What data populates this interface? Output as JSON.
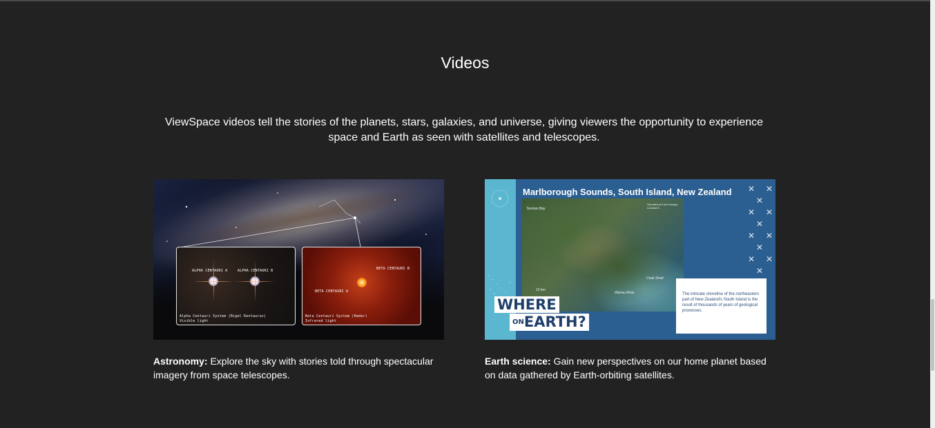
{
  "section": {
    "title": "Videos",
    "intro": "ViewSpace videos tell the stories of the planets, stars, galaxies, and universe, giving viewers the opportunity to experience space and Earth as seen with satellites and telescopes."
  },
  "cards": [
    {
      "category": "Astronomy:",
      "description": "Explore the sky with stories told through spectacular imagery from space telescopes.",
      "image": {
        "label_alpha_a": "ALPHA CENTAURI A",
        "label_alpha_b": "ALPHA CENTAURI B",
        "label_beta_a": "BETA CENTAURI A",
        "label_beta_b": "BETA CENTAURI B",
        "vis_caption_1": "Alpha Centauri System (Rigel Kentaurus)",
        "vis_caption_2": "Visible light",
        "ir_caption_1": "Beta Centauri System (Hadar)",
        "ir_caption_2": "Infrared light"
      }
    },
    {
      "category": "Earth science:",
      "description": "Gain new perspectives on our home planet based on data gathered by Earth-orbiting satellites.",
      "image": {
        "title": "Marlborough Sounds, South Island, New Zealand",
        "label_tasman": "Tasman Bay",
        "label_cook": "Cook Strait",
        "label_wairau": "Wairau River",
        "label_scale": "10 km",
        "label_credit": "Operational Land Imager, Landsat 8",
        "box_text": "The intricate shoreline of the northeastern part of New Zealand's South Island is the result of thousands of years of geological processes.",
        "where_line1": "WHERE",
        "where_on": "ON",
        "where_line2": "EARTH?"
      }
    }
  ]
}
